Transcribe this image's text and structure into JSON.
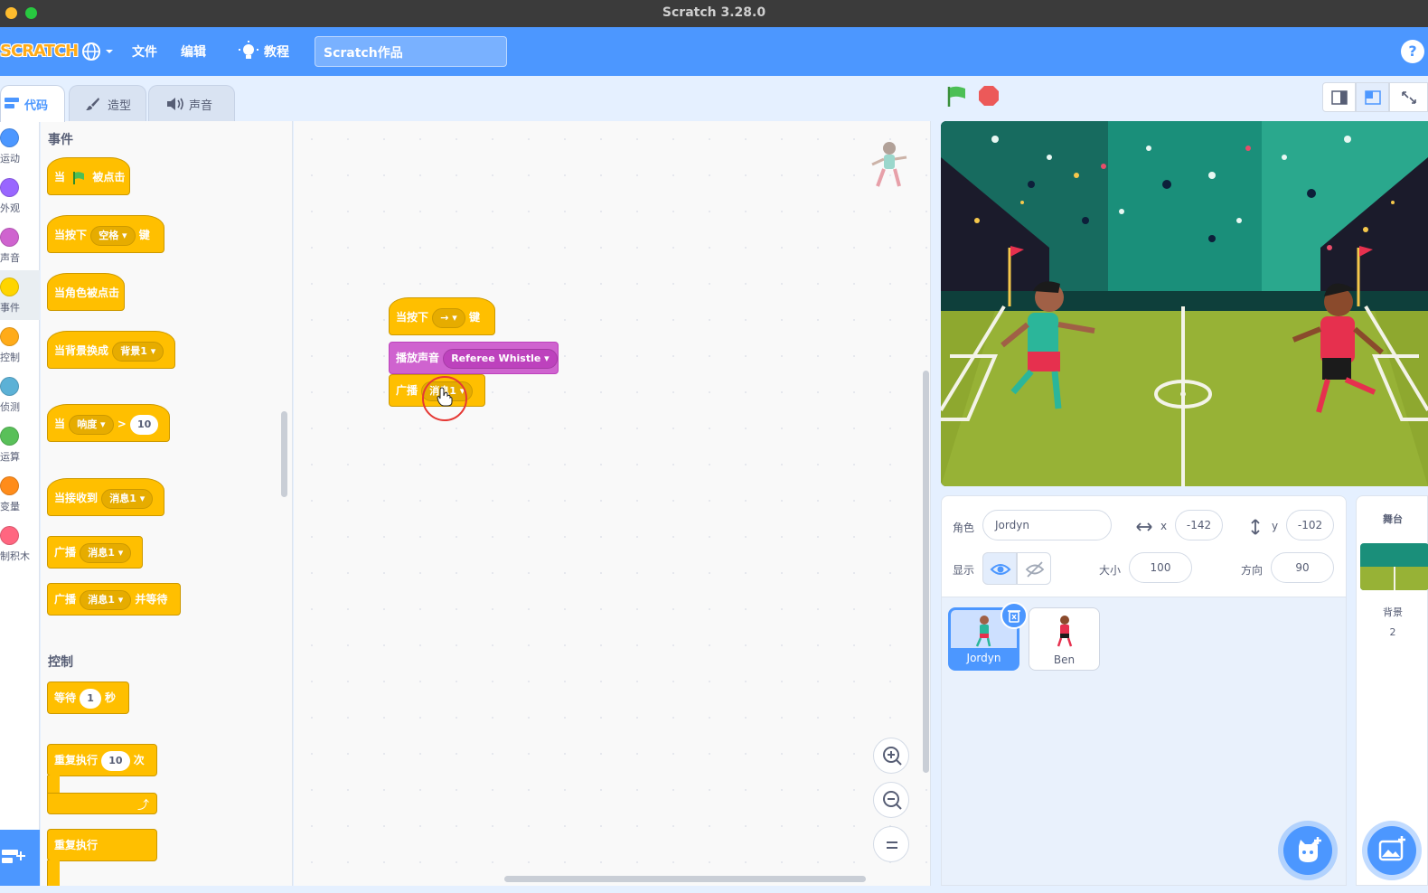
{
  "window": {
    "title": "Scratch 3.28.0"
  },
  "menu": {
    "logo_text": "SCRATCH",
    "file": "文件",
    "edit": "编辑",
    "tutorials": "教程",
    "project_title": "Scratch作品",
    "help": "?"
  },
  "tabs": {
    "code": "代码",
    "costumes": "造型",
    "sounds": "声音"
  },
  "categories": [
    {
      "label": "运动",
      "color": "#4c97ff"
    },
    {
      "label": "外观",
      "color": "#9966ff"
    },
    {
      "label": "声音",
      "color": "#cf63cf"
    },
    {
      "label": "事件",
      "color": "#ffd500"
    },
    {
      "label": "控制",
      "color": "#ffab19"
    },
    {
      "label": "侦测",
      "color": "#5cb1d6"
    },
    {
      "label": "运算",
      "color": "#59c059"
    },
    {
      "label": "变量",
      "color": "#ff8c1a"
    },
    {
      "label": "制积木",
      "color": "#ff6680"
    }
  ],
  "palette": {
    "events_title": "事件",
    "control_title": "控制",
    "when_flag": {
      "pre": "当",
      "post": "被点击"
    },
    "when_key": {
      "pre": "当按下",
      "key": "空格",
      "post": "键"
    },
    "when_sprite_clicked": "当角色被点击",
    "when_backdrop": {
      "pre": "当背景换成",
      "value": "背景1"
    },
    "when_greater": {
      "pre": "当",
      "field": "响度",
      "op": ">",
      "value": "10"
    },
    "when_receive": {
      "pre": "当接收到",
      "value": "消息1"
    },
    "broadcast": {
      "pre": "广播",
      "value": "消息1"
    },
    "broadcast_wait": {
      "pre": "广播",
      "value": "消息1",
      "post": "并等待"
    },
    "wait": {
      "pre": "等待",
      "value": "1",
      "post": "秒"
    },
    "repeat": {
      "pre": "重复执行",
      "value": "10",
      "post": "次"
    },
    "forever": "重复执行"
  },
  "script": {
    "when_key": {
      "pre": "当按下",
      "key": "→",
      "post": "键"
    },
    "play_sound": {
      "pre": "播放声音",
      "value": "Referee Whistle"
    },
    "broadcast": {
      "pre": "广播",
      "value": "消息1"
    }
  },
  "sprite_info": {
    "sprite_label": "角色",
    "sprite_name": "Jordyn",
    "x_label": "x",
    "x_value": "-142",
    "y_label": "y",
    "y_value": "-102",
    "show_label": "显示",
    "size_label": "大小",
    "size_value": "100",
    "direction_label": "方向",
    "direction_value": "90"
  },
  "sprites": [
    {
      "name": "Jordyn",
      "selected": true
    },
    {
      "name": "Ben",
      "selected": false
    }
  ],
  "stage_pane": {
    "title": "舞台",
    "backdrops_label": "背景",
    "backdrops_count": "2"
  }
}
